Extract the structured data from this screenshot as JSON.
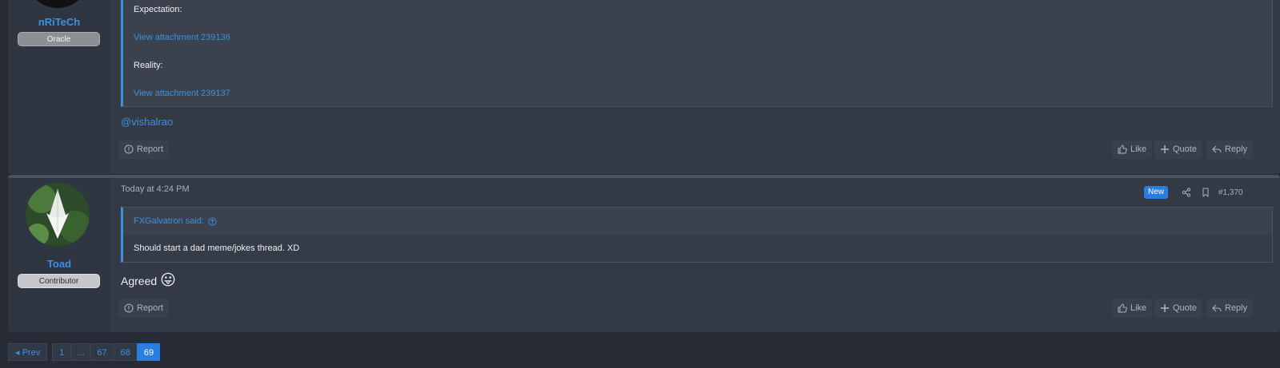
{
  "posts": [
    {
      "user": {
        "name": "nRiTeCh",
        "title": "Oracle"
      },
      "quote_lines": [
        "Expectation:",
        "View attachment 239136",
        "Reality:",
        "View attachment 239137"
      ],
      "body_mention": "@vishalrao",
      "actions": {
        "report": "Report",
        "like": "Like",
        "quote": "Quote",
        "reply": "Reply"
      }
    },
    {
      "user": {
        "name": "Toad",
        "title": "Contributor"
      },
      "date": "Today at 4:24 PM",
      "badge": "New",
      "post_number": "#1,370",
      "quote_author": "FXGalvatron said:",
      "quote_text": "Should start a dad meme/jokes thread. XD",
      "body_text": "Agreed",
      "emoji": "😛",
      "actions": {
        "report": "Report",
        "like": "Like",
        "quote": "Quote",
        "reply": "Reply"
      }
    }
  ],
  "pagination": {
    "prev_label": "◂ Prev",
    "pages": [
      "1",
      "…",
      "67",
      "68",
      "69"
    ],
    "current": "69"
  }
}
